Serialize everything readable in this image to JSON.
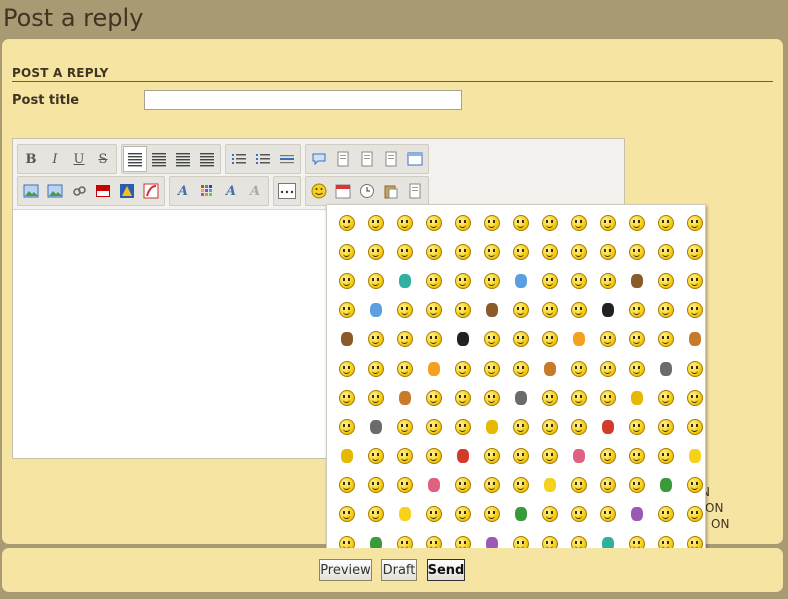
{
  "page": {
    "title": "Post a reply"
  },
  "form": {
    "section_title": "POST A REPLY",
    "post_title_label": "Post title",
    "post_title_value": ""
  },
  "toolbar": {
    "row1": [
      [
        {
          "name": "bold",
          "glyph": "B"
        },
        {
          "name": "italic",
          "glyph": "I"
        },
        {
          "name": "underline",
          "glyph": "U"
        },
        {
          "name": "strikethrough",
          "glyph": "S"
        }
      ],
      [
        {
          "name": "align-left",
          "glyph": "align",
          "active": true
        },
        {
          "name": "align-center",
          "glyph": "align"
        },
        {
          "name": "align-right",
          "glyph": "align"
        },
        {
          "name": "justify",
          "glyph": "align"
        }
      ],
      [
        {
          "name": "bullet-list",
          "glyph": "list"
        },
        {
          "name": "numbered-list",
          "glyph": "list"
        },
        {
          "name": "horizontal-rule",
          "glyph": "hr"
        }
      ],
      [
        {
          "name": "quote",
          "glyph": "bubble"
        },
        {
          "name": "code",
          "glyph": "doc"
        },
        {
          "name": "spoiler",
          "glyph": "doc"
        },
        {
          "name": "edit-source",
          "glyph": "doc"
        },
        {
          "name": "table",
          "glyph": "table"
        }
      ]
    ],
    "row2": [
      [
        {
          "name": "insert-image",
          "glyph": "img"
        },
        {
          "name": "upload-image",
          "glyph": "img"
        },
        {
          "name": "link",
          "glyph": "link"
        },
        {
          "name": "youtube",
          "glyph": "yt"
        },
        {
          "name": "warning",
          "glyph": "warn"
        },
        {
          "name": "flash",
          "glyph": "flash"
        }
      ],
      [
        {
          "name": "font-size",
          "glyph": "A"
        },
        {
          "name": "text-color",
          "glyph": "grid"
        },
        {
          "name": "font-face",
          "glyph": "A"
        },
        {
          "name": "remove-format",
          "glyph": "A"
        }
      ],
      [
        {
          "name": "more",
          "glyph": "dots"
        }
      ],
      [
        {
          "name": "smiley",
          "glyph": "smile"
        },
        {
          "name": "date",
          "glyph": "cal"
        },
        {
          "name": "time",
          "glyph": "clock"
        },
        {
          "name": "paste",
          "glyph": "paste"
        },
        {
          "name": "paste-text",
          "glyph": "doc"
        }
      ]
    ]
  },
  "emoji_palette": {
    "columns": 13,
    "rows": 12,
    "colors": [
      "#f7d21c",
      "#e6b800",
      "#f4a020",
      "#5aa0e0",
      "#3a9a3a",
      "#d23a2a",
      "#c77b2a",
      "#8b5a2b",
      "#9b59b6",
      "#e06080",
      "#6b6b6b",
      "#222222",
      "#2fb0a0"
    ]
  },
  "side_labels": [
    "N",
    "ON",
    "ON"
  ],
  "buttons": {
    "preview": "Preview",
    "draft": "Draft",
    "send": "Send"
  }
}
